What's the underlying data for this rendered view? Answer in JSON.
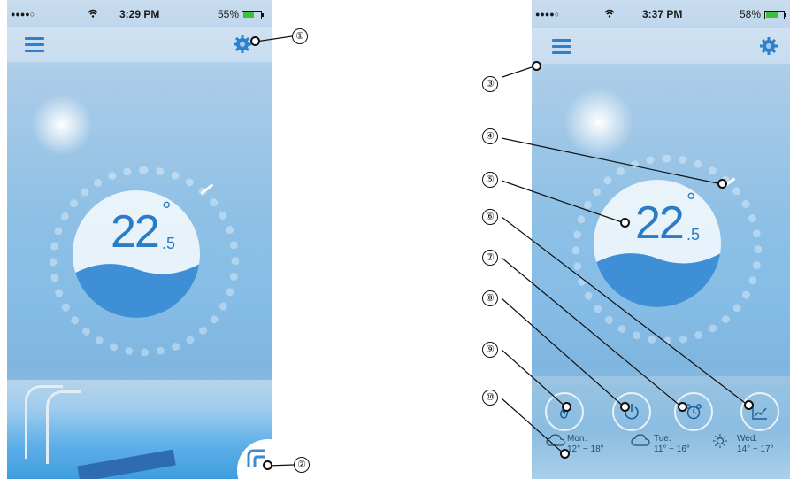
{
  "left_screen": {
    "status": {
      "signal": "●●●●○",
      "time": "3:29 PM",
      "battery": "55%"
    },
    "temperature": {
      "whole": "22",
      "degree": "°",
      "decimal": ".5"
    }
  },
  "right_screen": {
    "status": {
      "signal": "●●●●○",
      "time": "3:37 PM",
      "battery": "58%"
    },
    "temperature": {
      "whole": "22",
      "degree": "°",
      "decimal": ".5"
    },
    "weather": [
      {
        "day": "Mon.",
        "range": "12° ~ 18°",
        "icon": "cloud-icon"
      },
      {
        "day": "Tue.",
        "range": "11° ~ 16°",
        "icon": "cloud-icon"
      },
      {
        "day": "Wed.",
        "range": "14° ~ 17°",
        "icon": "sun-icon"
      }
    ]
  },
  "callouts": [
    "①",
    "②",
    "③",
    "④",
    "⑤",
    "⑥",
    "⑦",
    "⑧",
    "⑨",
    "⑩"
  ],
  "colors": {
    "accent": "#2d7fcf",
    "sky": "#8ec0e6"
  }
}
